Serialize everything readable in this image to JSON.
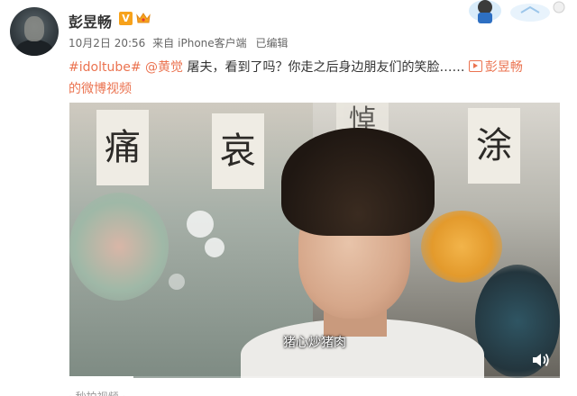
{
  "post": {
    "username": "彭昱畅",
    "verified_badge": "V",
    "meta": {
      "date": "10月2日 20:56",
      "source_prefix": "来自",
      "source": "iPhone客户端",
      "edited": "已编辑"
    },
    "content": {
      "hashtag": "#idoltube#",
      "mention": "@黄觉",
      "text": "屠夫，看到了吗？你走之后身边朋友们的笑脸……",
      "video_link": "彭昱畅的微博视频"
    }
  },
  "video": {
    "banners": [
      "痛",
      "哀",
      "悼",
      "涂"
    ],
    "subtitle": "猪心炒猪肉",
    "progress": 0.13
  },
  "below_text": "· 秒拍视频 ·",
  "icons": {
    "verified": "verified-v-icon",
    "vip": "vip-crown-icon",
    "video_link": "video-play-icon",
    "volume": "volume-icon"
  },
  "colors": {
    "link": "#eb7350",
    "verified": "#f7a21b",
    "meta_text": "#666666"
  }
}
